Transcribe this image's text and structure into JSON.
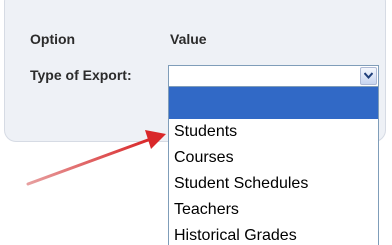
{
  "table": {
    "header_option": "Option",
    "header_value": "Value",
    "row_label": "Type of Export:"
  },
  "select": {
    "current_value": "",
    "arrow_icon": "chevron-down-icon"
  },
  "dropdown": {
    "options": [
      "",
      "Students",
      "Courses",
      "Student Schedules",
      "Teachers",
      "Historical Grades"
    ],
    "selected_index": 0
  },
  "annotation": {
    "arrow_color": "#d9282a"
  },
  "colors": {
    "panel_bg": "#eef1f6",
    "highlight": "#3169c6",
    "border": "#7f9db9"
  }
}
